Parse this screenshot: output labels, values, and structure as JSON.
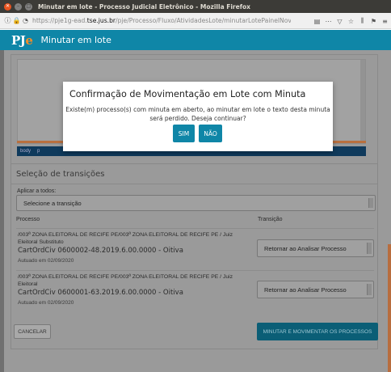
{
  "window": {
    "title": "Minutar em lote - Processo Judicial Eletrônico - Mozilla Firefox"
  },
  "browser": {
    "url_prefix": "https://pje1g-ead.",
    "url_domain": "tse.jus.br",
    "url_path": "/pje/Processo/Fluxo/AtividadesLote/minutarLotePainelNovoCK"
  },
  "app": {
    "logo_prefix": "PJ",
    "logo_suffix": "e",
    "page_title": "Minutar em lote"
  },
  "editor": {
    "status_items": [
      "body",
      "p"
    ]
  },
  "transitions": {
    "section_title": "Seleção de transições",
    "apply_all_label": "Aplicar a todos:",
    "apply_all_placeholder": "Selecione a transição",
    "columns": {
      "process": "Processo",
      "transition": "Transição"
    },
    "rows": [
      {
        "orgao": "/003ª ZONA ELEITORAL DE RECIFE PE/003ª ZONA ELEITORAL DE RECIFE PE / Juiz Eleitoral Substituto",
        "process": "CartOrdCiv 0600002-48.2019.6.00.0000 - Oitiva",
        "autuado": "Autuado em 02/09/2020",
        "transition": "Retornar ao Analisar Processo"
      },
      {
        "orgao": "/003ª ZONA ELEITORAL DE RECIFE PE/003ª ZONA ELEITORAL DE RECIFE PE / Juiz Eleitoral",
        "process": "CartOrdCiv 0600001-63.2019.6.00.0000 - Oitiva",
        "autuado": "Autuado em 02/09/2020",
        "transition": "Retornar ao Analisar Processo"
      }
    ]
  },
  "actions": {
    "cancel_label": "CANCELAR",
    "submit_label": "MINUTAR E MOVIMENTAR OS PROCESSOS"
  },
  "modal": {
    "title": "Confirmação de Movimentação em Lote com Minuta",
    "message": "Existe(m) processo(s) com minuta em aberto, ao minutar em lote o texto desta minuta será perdido. Deseja continuar?",
    "yes_label": "SIM",
    "no_label": "NÃO"
  }
}
